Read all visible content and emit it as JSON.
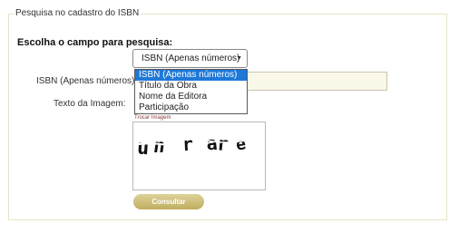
{
  "fieldset": {
    "legend": "Pesquisa no cadastro do ISBN"
  },
  "form": {
    "section_title": "Escolha o campo para pesquisa:",
    "isbn_label": "ISBN (Apenas números):",
    "isbn_value": "",
    "captcha_label": "Texto da Imagem:",
    "captcha_refresh_link": "Trocar Imagem",
    "captcha_text": "unrare",
    "submit_label": "Consultar"
  },
  "search_field_select": {
    "selected": "ISBN (Apenas números)",
    "expanded": true,
    "options": [
      "ISBN (Apenas números)",
      "Título da Obra",
      "Nome da Editora",
      "Participação"
    ]
  },
  "colors": {
    "fieldset_border": "#e8e4c4",
    "input_background": "#faf8e8",
    "option_highlight": "#1e78d8",
    "button_gold": "#cdbd75",
    "refresh_link": "#8a3a3a"
  }
}
